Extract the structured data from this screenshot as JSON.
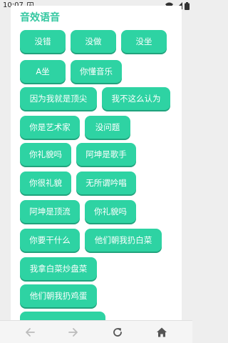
{
  "status_bar": {
    "time": "10:07",
    "notification_letter": "A"
  },
  "section_title": "音效语音",
  "sound_buttons": [
    "没错",
    "没做",
    "没坐",
    "A坐",
    "你懂音乐",
    "因为我就是顶尖",
    "我不这么认为",
    "你是艺术家",
    "没问题",
    "你礼貌吗",
    "阿坤是歌手",
    "你很礼貌",
    "无所谓吟唱",
    "阿坤是顶流",
    "你礼貌吗",
    "你要干什么",
    "他们朝我扔白菜",
    "我拿白菜炒盘菜",
    "他们朝我扔鸡蛋"
  ],
  "icons": {
    "back": "arrow-left-icon",
    "forward": "arrow-right-icon",
    "reload": "reload-icon",
    "home": "home-icon"
  },
  "colors": {
    "accent": "#2ed3a3",
    "title": "#33c7a0"
  }
}
